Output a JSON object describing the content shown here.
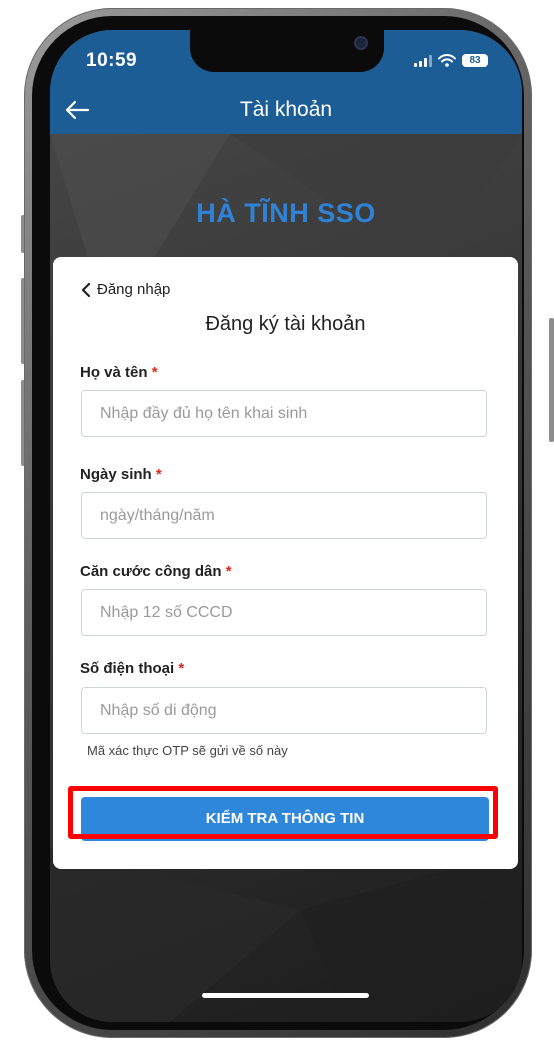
{
  "status_bar": {
    "time": "10:59",
    "battery": "83"
  },
  "nav": {
    "title": "Tài khoản"
  },
  "brand": {
    "name": "HÀ TĨNH SSO"
  },
  "form": {
    "back_label": "Đăng nhập",
    "title": "Đăng ký tài khoản",
    "required_mark": "*",
    "fields": [
      {
        "label": "Họ và tên",
        "placeholder": "Nhập đầy đủ họ tên khai sinh",
        "value": ""
      },
      {
        "label": "Ngày sinh",
        "placeholder": "ngày/tháng/năm",
        "value": ""
      },
      {
        "label": "Căn cước công dân",
        "placeholder": "Nhập 12 số CCCD",
        "value": ""
      },
      {
        "label": "Số điện thoại",
        "placeholder": "Nhập số di động",
        "value": ""
      }
    ],
    "otp_hint": "Mã xác thực OTP sẽ gửi về số này",
    "submit_label": "KIỂM TRA THÔNG TIN"
  },
  "colors": {
    "header": "#1d5d96",
    "brand": "#2f83d6",
    "button": "#2f87db",
    "highlight": "#ff0000",
    "required": "#e0261c"
  },
  "icons": {
    "back": "arrow-left-icon",
    "back_link": "chevron-left-icon",
    "signal": "signal-icon",
    "wifi": "wifi-icon",
    "battery": "battery-icon"
  }
}
